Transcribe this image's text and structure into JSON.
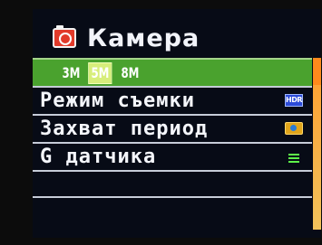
{
  "header": {
    "title": "Камера",
    "icon": "camera-icon"
  },
  "menu": {
    "resolution": {
      "options": [
        "3M",
        "5M",
        "8M"
      ],
      "selected": "5M"
    },
    "items": [
      {
        "label": "Режим съемки",
        "icon": "hdr-icon",
        "icon_text": "HDR"
      },
      {
        "label": "Захват период",
        "icon": "capture-icon"
      },
      {
        "label": "G датчика",
        "icon": "gsensor-icon"
      },
      {
        "label": ""
      }
    ]
  },
  "colors": {
    "selection": "#4aa22e",
    "scrollbar": "#ff9d2e",
    "background": "#070b16"
  }
}
